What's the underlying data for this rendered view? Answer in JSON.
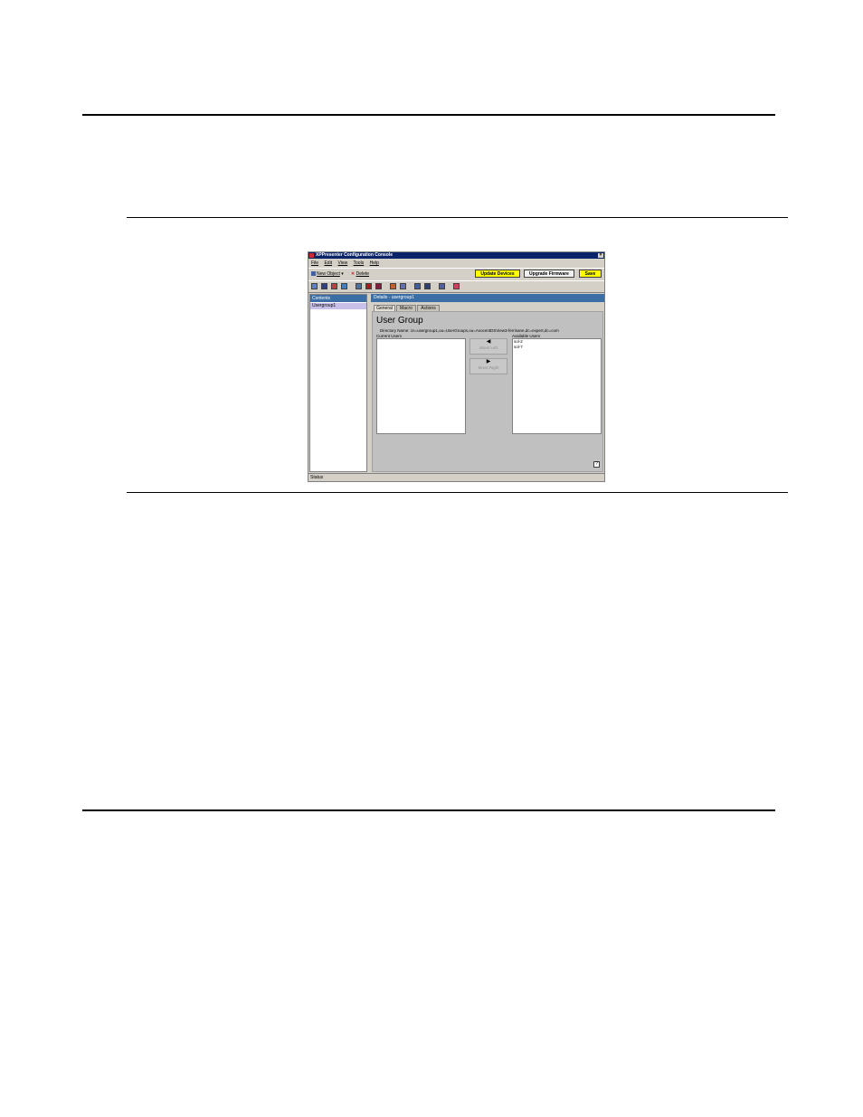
{
  "window": {
    "title": "XPPresenter Configuration Console",
    "close_glyph": "×"
  },
  "menu": [
    "File",
    "Edit",
    "View",
    "Tools",
    "Help"
  ],
  "toolbar": {
    "new_object": "New Object",
    "delete": "Delete",
    "update_devices": "Update Devices",
    "upgrade_firmware": "Upgrade Firmware",
    "save": "Save",
    "highlight_color": "#ffff00"
  },
  "tree": {
    "header": "Contents",
    "items": [
      "Usergroup1"
    ]
  },
  "details": {
    "header": "Details - usergroup1",
    "tabs": [
      "General",
      "Macro",
      "Actions"
    ],
    "title": "User Group",
    "directory_name": "Directory Name: cn=usergroup1,ou=UserGroups,ou=AvocentDSView3-ferrisane,dc=expert,dc=com",
    "current_users_label": "Current Users",
    "available_users_label": "Available Users",
    "current_users": [],
    "available_users": [
      "sol-2",
      "sol-7"
    ],
    "move_left": "Move Left",
    "move_right": "Move Right",
    "move_left_glyph": "◀",
    "move_right_glyph": "▶",
    "help_glyph": "?"
  },
  "status": "Status"
}
